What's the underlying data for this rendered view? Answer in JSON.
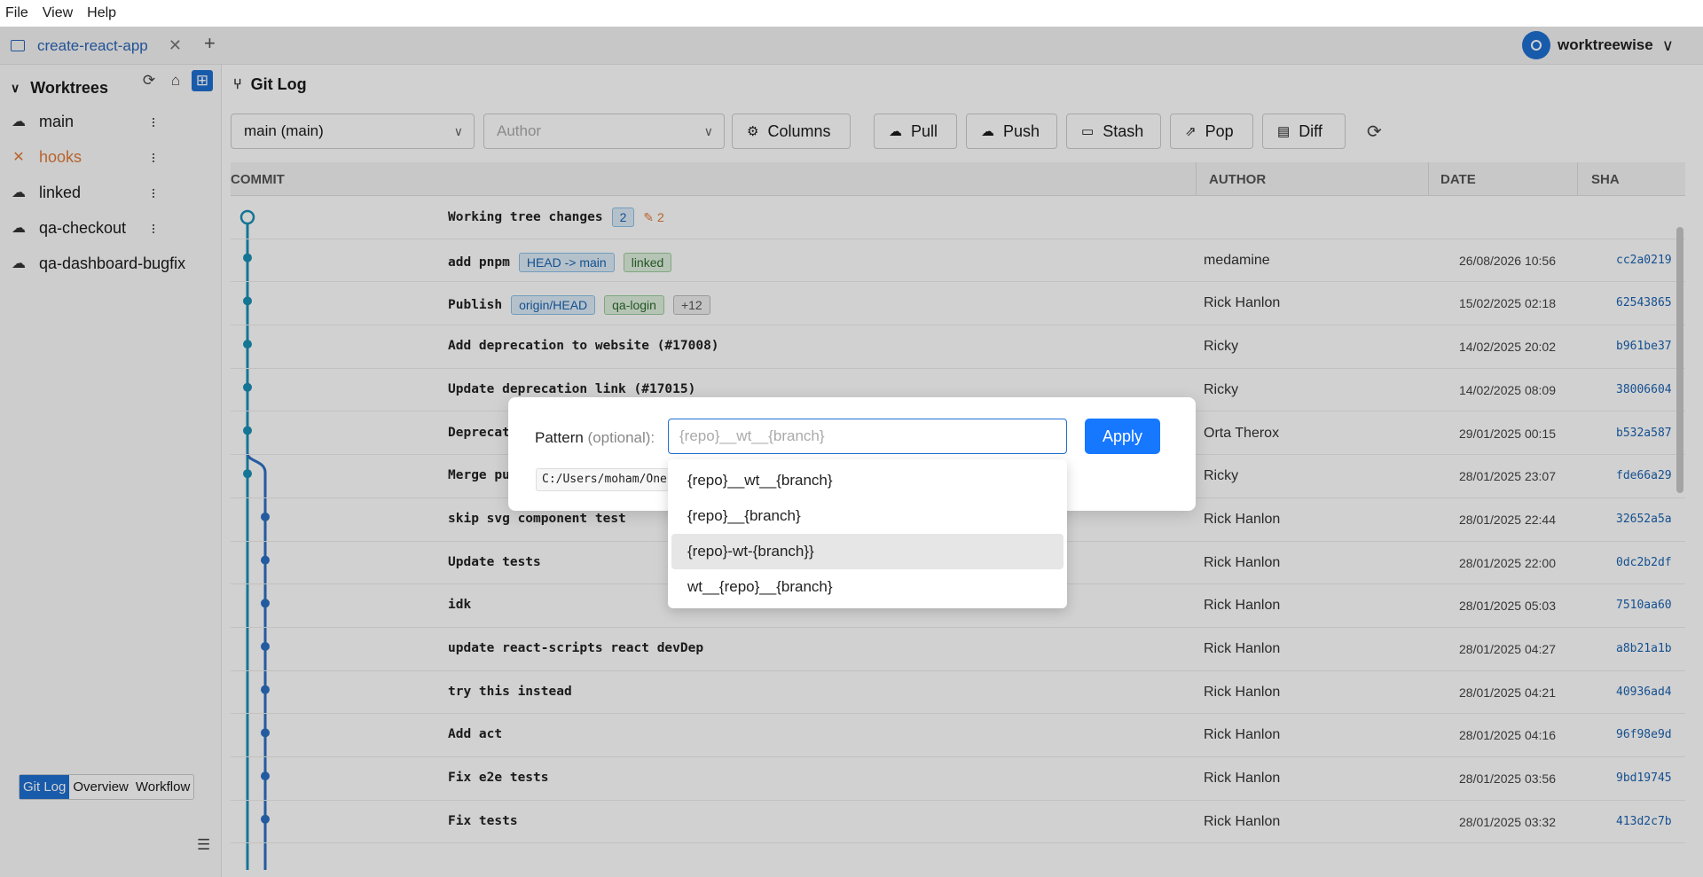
{
  "menu": [
    "File",
    "View",
    "Help"
  ],
  "tab": {
    "title": "create-react-app",
    "close": "✕",
    "add": "+"
  },
  "user": {
    "name": "worktreewise"
  },
  "sidebar": {
    "title": "Worktrees",
    "items": [
      {
        "label": "main",
        "status": "ok"
      },
      {
        "label": "hooks",
        "status": "error"
      },
      {
        "label": "linked",
        "status": "ok"
      },
      {
        "label": "qa-checkout",
        "status": "ok"
      },
      {
        "label": "qa-dashboard-bugfix",
        "status": "ok"
      }
    ],
    "views": [
      "Git Log",
      "Overview",
      "Workflow"
    ]
  },
  "main": {
    "title": "Git Log",
    "branch_select": "main (main)",
    "author_placeholder": "Author",
    "buttons": {
      "columns": "Columns",
      "pull": "Pull",
      "push": "Push",
      "stash": "Stash",
      "pop": "Pop",
      "diff": "Diff"
    },
    "headers": {
      "commit": "COMMIT",
      "author": "AUTHOR",
      "date": "DATE",
      "sha": "SHA"
    },
    "working": {
      "label": "Working tree changes",
      "count": "2",
      "edits": "2"
    },
    "rows": [
      {
        "msg": "add pnpm",
        "badges": [
          "HEAD -> main",
          "linked"
        ],
        "author": "medamine",
        "date": "26/08/2026 10:56",
        "sha": "cc2a0219"
      },
      {
        "msg": "Publish",
        "badges": [
          "origin/HEAD",
          "qa-login",
          "+12"
        ],
        "author": "Rick Hanlon",
        "date": "15/02/2025 02:18",
        "sha": "62543865"
      },
      {
        "msg": "Add deprecation to website (#17008)",
        "badges": [],
        "author": "Ricky",
        "date": "14/02/2025 20:02",
        "sha": "b961be37"
      },
      {
        "msg": "Update deprecation link (#17015)",
        "badges": [],
        "author": "Ricky",
        "date": "14/02/2025 08:09",
        "sha": "38006604"
      },
      {
        "msg": "Deprecat",
        "badges": [],
        "author": "Orta Therox",
        "date": "29/01/2025 00:15",
        "sha": "b532a587"
      },
      {
        "msg": "Merge pu",
        "badges": [],
        "author": "Ricky",
        "date": "28/01/2025 23:07",
        "sha": "fde66a29"
      },
      {
        "msg": "skip svg component test",
        "badges": [],
        "author": "Rick Hanlon",
        "date": "28/01/2025 22:44",
        "sha": "32652a5a"
      },
      {
        "msg": "Update tests",
        "badges": [],
        "author": "Rick Hanlon",
        "date": "28/01/2025 22:00",
        "sha": "0dc2b2df"
      },
      {
        "msg": "idk",
        "badges": [],
        "author": "Rick Hanlon",
        "date": "28/01/2025 05:03",
        "sha": "7510aa60"
      },
      {
        "msg": "update react-scripts react devDep",
        "badges": [],
        "author": "Rick Hanlon",
        "date": "28/01/2025 04:27",
        "sha": "a8b21a1b"
      },
      {
        "msg": "try this instead",
        "badges": [],
        "author": "Rick Hanlon",
        "date": "28/01/2025 04:21",
        "sha": "40936ad4"
      },
      {
        "msg": "Add act",
        "badges": [],
        "author": "Rick Hanlon",
        "date": "28/01/2025 04:16",
        "sha": "96f98e9d"
      },
      {
        "msg": "Fix e2e tests",
        "badges": [],
        "author": "Rick Hanlon",
        "date": "28/01/2025 03:56",
        "sha": "9bd19745"
      },
      {
        "msg": "Fix tests",
        "badges": [],
        "author": "Rick Hanlon",
        "date": "28/01/2025 03:32",
        "sha": "413d2c7b"
      }
    ]
  },
  "modal": {
    "label": "Pattern",
    "label_optional": "(optional):",
    "placeholder": "{repo}__wt__{branch}",
    "apply": "Apply",
    "path": "C:/Users/moham/One",
    "options": [
      "{repo}__wt__{branch}",
      "{repo}__{branch}",
      "{repo}-wt-{branch}}",
      "wt__{repo}__{branch}"
    ]
  },
  "colors": {
    "accent": "#1f6fd1",
    "graph": "#1a8fb5",
    "graph2": "#2c6fc4",
    "error": "#e07b39"
  }
}
